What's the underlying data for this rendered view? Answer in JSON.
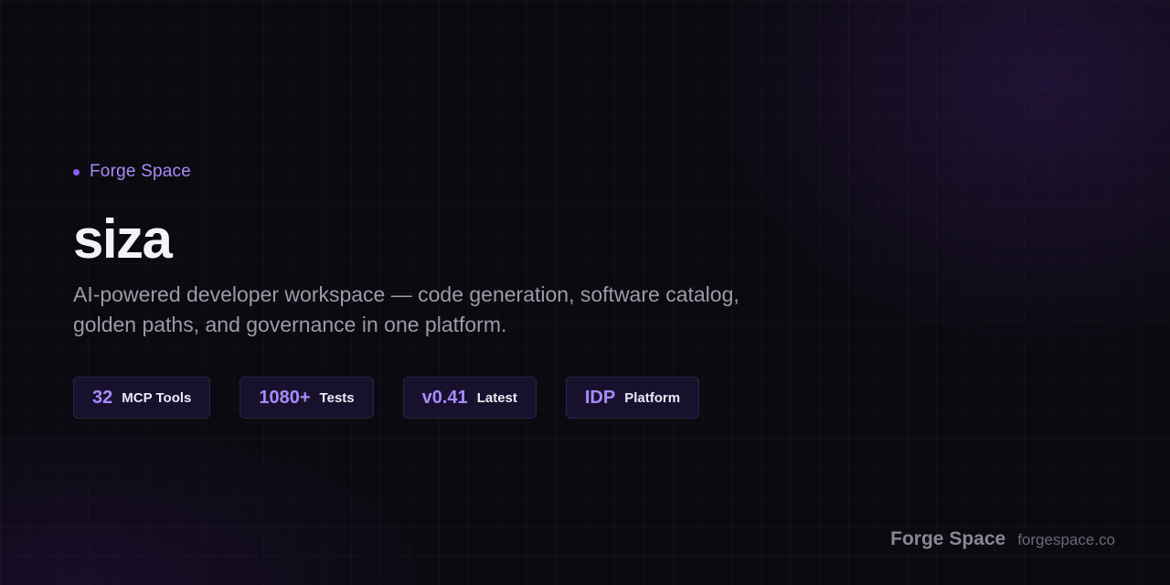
{
  "header": {
    "brand_label": "Forge Space"
  },
  "hero": {
    "title": "siza",
    "description": "AI-powered developer workspace — code generation, software catalog, golden paths, and governance in one platform."
  },
  "stats": [
    {
      "value": "32",
      "label": "MCP Tools"
    },
    {
      "value": "1080+",
      "label": "Tests"
    },
    {
      "value": "v0.41",
      "label": "Latest"
    },
    {
      "value": "IDP",
      "label": "Platform"
    }
  ],
  "footer": {
    "brand": "Forge Space",
    "url": "forgespace.co"
  },
  "colors": {
    "accent": "#a78bfa",
    "background": "#0b0a10"
  }
}
